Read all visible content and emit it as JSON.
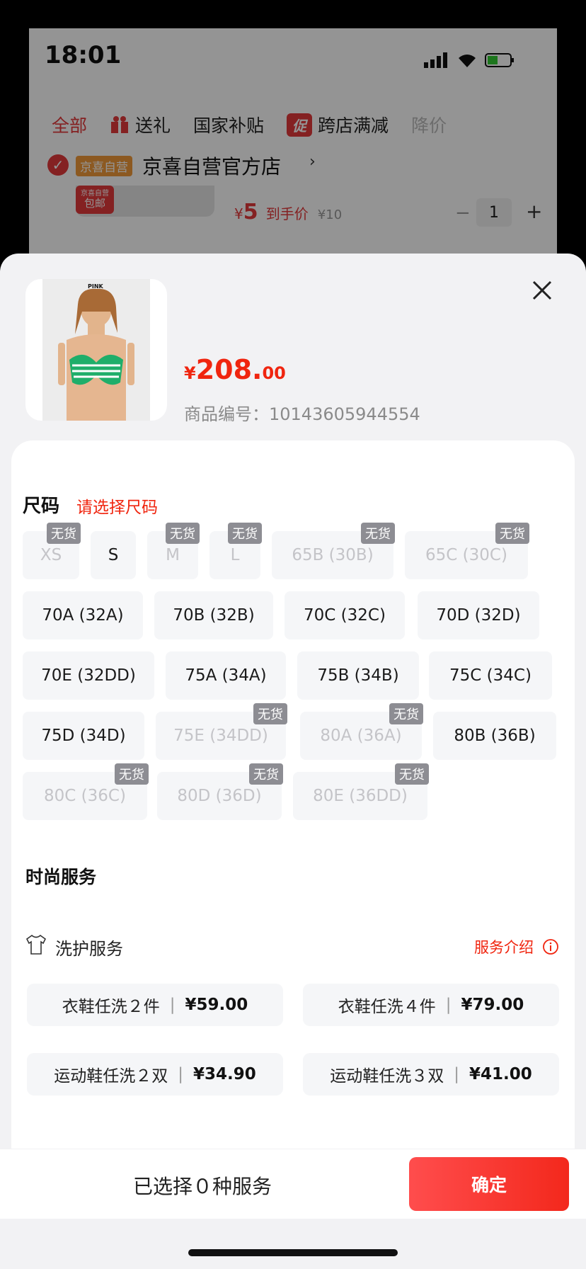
{
  "status_bar": {
    "time": "18:01"
  },
  "background_cart": {
    "tabs": [
      {
        "label": "全部",
        "active": true
      },
      {
        "label": "送礼",
        "icon": "gift-icon"
      },
      {
        "label": "国家补贴"
      },
      {
        "label": "跨店满减",
        "badge": "促"
      },
      {
        "label": "降价"
      }
    ],
    "shop_tag": "京喜自营",
    "shop_name": "京喜自营官方店",
    "item_tag_line1": "京喜自营",
    "item_tag_line2": "包邮",
    "item_price_symbol": "¥",
    "item_price": "5",
    "item_price_label": "到手价",
    "item_original_price": "¥10",
    "quantity": "1",
    "minus": "−",
    "plus": "+"
  },
  "product": {
    "image_brand_text": "PINK",
    "price_symbol": "¥",
    "price_int": "208.",
    "price_dec": "00",
    "sku_label": "商品编号：",
    "sku_value": "10143605944554"
  },
  "size_section": {
    "title": "尺码",
    "hint": "请选择尺码",
    "sold_out_label": "无货",
    "options": [
      {
        "label": "XS",
        "available": false
      },
      {
        "label": "S",
        "available": true
      },
      {
        "label": "M",
        "available": false
      },
      {
        "label": "L",
        "available": false
      },
      {
        "label": "65B (30B)",
        "available": false
      },
      {
        "label": "65C (30C)",
        "available": false
      },
      {
        "label": "70A (32A)",
        "available": true
      },
      {
        "label": "70B (32B)",
        "available": true
      },
      {
        "label": "70C (32C)",
        "available": true
      },
      {
        "label": "70D (32D)",
        "available": true
      },
      {
        "label": "70E (32DD)",
        "available": true
      },
      {
        "label": "75A (34A)",
        "available": true
      },
      {
        "label": "75B (34B)",
        "available": true
      },
      {
        "label": "75C (34C)",
        "available": true
      },
      {
        "label": "75D (34D)",
        "available": true
      },
      {
        "label": "75E (34DD)",
        "available": false
      },
      {
        "label": "80A (36A)",
        "available": false
      },
      {
        "label": "80B (36B)",
        "available": true
      },
      {
        "label": "80C (36C)",
        "available": false
      },
      {
        "label": "80D (36D)",
        "available": false
      },
      {
        "label": "80E (36DD)",
        "available": false
      }
    ]
  },
  "fashion_service": {
    "title": "时尚服务",
    "laundry_label": "洗护服务",
    "laundry_icon": "tshirt-icon",
    "intro_link": "服务介绍",
    "intro_icon": "info-icon",
    "items": [
      {
        "name": "衣鞋任洗２件",
        "sep": "|",
        "price": "¥59.00"
      },
      {
        "name": "衣鞋任洗４件",
        "sep": "|",
        "price": "¥79.00"
      },
      {
        "name": "运动鞋任洗２双",
        "sep": "|",
        "price": "¥34.90"
      },
      {
        "name": "运动鞋任洗３双",
        "sep": "|",
        "price": "¥41.00"
      }
    ]
  },
  "footer": {
    "selected_text": "已选择０种服务",
    "confirm_label": "确定"
  },
  "colors": {
    "accent": "#f0250f",
    "confirm_start": "#ff4d4d",
    "confirm_end": "#f3281c",
    "sold_out_badge": "#8d8d93"
  }
}
